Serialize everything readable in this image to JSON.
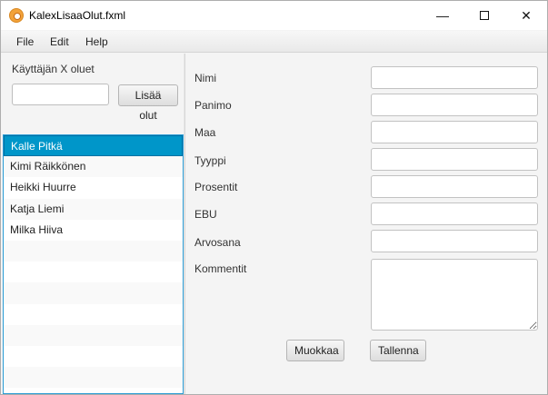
{
  "window": {
    "title": "KalexLisaaOlut.fxml"
  },
  "menu": {
    "items": [
      "File",
      "Edit",
      "Help"
    ]
  },
  "left": {
    "heading": "Käyttäjän X oluet",
    "search_value": "",
    "add_button": "Lisää olut",
    "users": [
      "Kalle Pitkä",
      "Kimi Räikkönen",
      "Heikki Huurre",
      "Katja Liemi",
      "Milka Hiiva"
    ],
    "selected_index": 0
  },
  "form": {
    "labels": {
      "name": "Nimi",
      "brewery": "Panimo",
      "country": "Maa",
      "type": "Tyyppi",
      "percent": "Prosentit",
      "ebu": "EBU",
      "rating": "Arvosana",
      "comments": "Kommentit"
    },
    "values": {
      "name": "",
      "brewery": "",
      "country": "",
      "type": "",
      "percent": "",
      "ebu": "",
      "rating": "",
      "comments": ""
    },
    "edit_button": "Muokkaa",
    "save_button": "Tallenna"
  }
}
